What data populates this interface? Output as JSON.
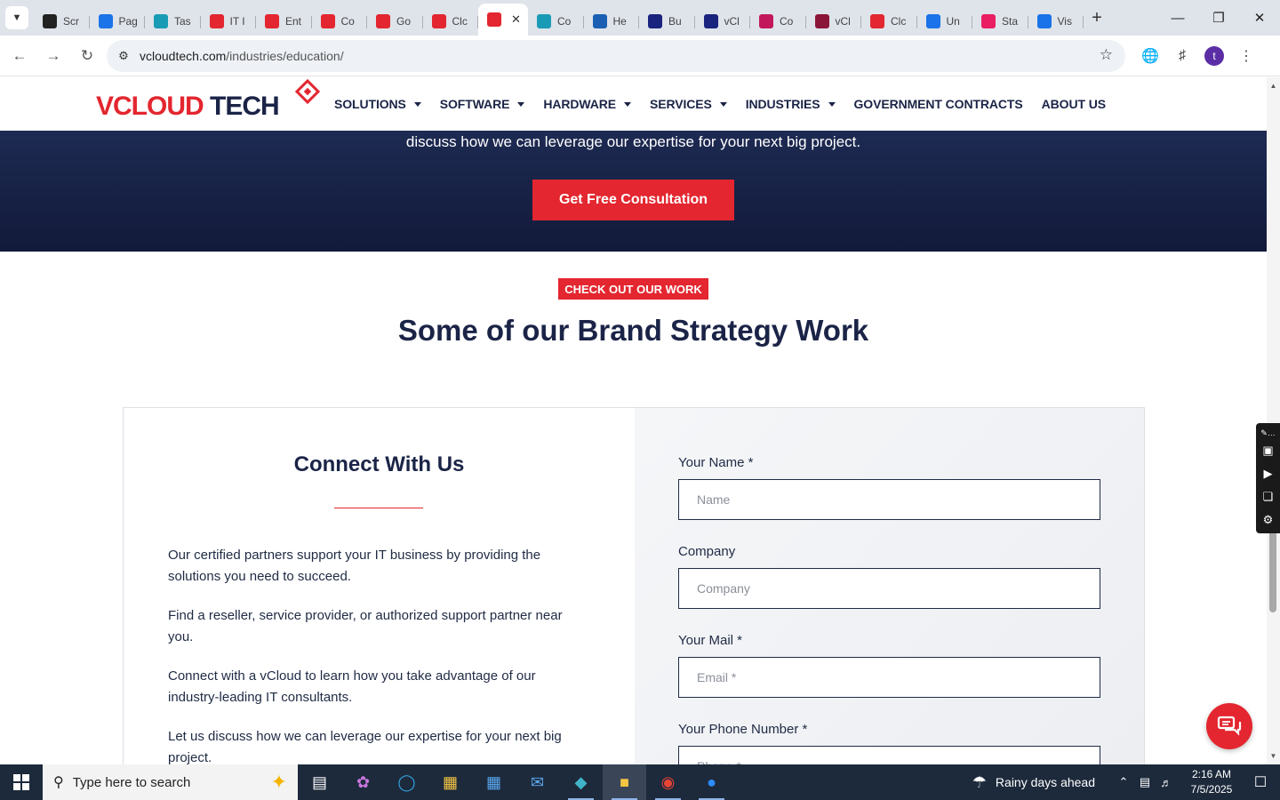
{
  "browser": {
    "tabs": [
      {
        "label": "Scr",
        "color": "#222222"
      },
      {
        "label": "Pag",
        "color": "#1a73e8"
      },
      {
        "label": "Tas",
        "color": "#1a9bb5"
      },
      {
        "label": "IT I",
        "color": "#e3262f"
      },
      {
        "label": "Ent",
        "color": "#e3262f"
      },
      {
        "label": "Co",
        "color": "#e3262f"
      },
      {
        "label": "Go",
        "color": "#e3262f"
      },
      {
        "label": "Clc",
        "color": "#e3262f"
      },
      {
        "label": "",
        "color": "#e3262f",
        "active": true
      },
      {
        "label": "Co",
        "color": "#1a9bb5"
      },
      {
        "label": "He",
        "color": "#1a5fb4"
      },
      {
        "label": "Bu",
        "color": "#1a237e"
      },
      {
        "label": "vCl",
        "color": "#1a237e"
      },
      {
        "label": "Co",
        "color": "#c2185b"
      },
      {
        "label": "vCl",
        "color": "#8b1538"
      },
      {
        "label": "Clc",
        "color": "#e3262f"
      },
      {
        "label": "Un",
        "color": "#1a73e8"
      },
      {
        "label": "Sta",
        "color": "#e91e63"
      },
      {
        "label": "Vis",
        "color": "#1a73e8"
      }
    ],
    "url_host": "vcloudtech.com",
    "url_path": "/industries/education/",
    "profile_initial": "t"
  },
  "site": {
    "logo_v": "V",
    "logo_cloud": "CLOUD",
    "logo_tech": "TECH",
    "nav": [
      {
        "label": "SOLUTIONS",
        "dropdown": true
      },
      {
        "label": "SOFTWARE",
        "dropdown": true
      },
      {
        "label": "HARDWARE",
        "dropdown": true
      },
      {
        "label": "SERVICES",
        "dropdown": true
      },
      {
        "label": "INDUSTRIES",
        "dropdown": true
      },
      {
        "label": "GOVERNMENT CONTRACTS",
        "dropdown": false
      },
      {
        "label": "ABOUT US",
        "dropdown": false
      }
    ]
  },
  "hero": {
    "lead": "discuss how we can leverage our expertise for your next big project.",
    "cta_label": "Get Free Consultation"
  },
  "work": {
    "eyebrow": "CHECK OUT OUR WORK",
    "title": "Some of our Brand Strategy Work"
  },
  "connect": {
    "title": "Connect With Us",
    "paragraphs": [
      "Our certified partners support your IT business by providing the solutions you need to succeed.",
      "Find a reseller, service provider, or authorized support partner near you.",
      "Connect with a vCloud to learn how you take advantage of our industry-leading IT consultants.",
      "Let us discuss how we can leverage our expertise for your next big project."
    ]
  },
  "form": {
    "name_label": "Your Name *",
    "name_placeholder": "Name",
    "company_label": "Company",
    "company_placeholder": "Company",
    "mail_label": "Your Mail *",
    "mail_placeholder": "Email *",
    "phone_label": "Your Phone Number *",
    "phone_placeholder": "Phone *"
  },
  "taskbar": {
    "search_placeholder": "Type here to search",
    "weather": "Rainy days ahead",
    "time": "2:16 AM",
    "date": "7/5/2025"
  },
  "colors": {
    "brand_red": "#e3262f",
    "brand_navy": "#1b2447"
  }
}
